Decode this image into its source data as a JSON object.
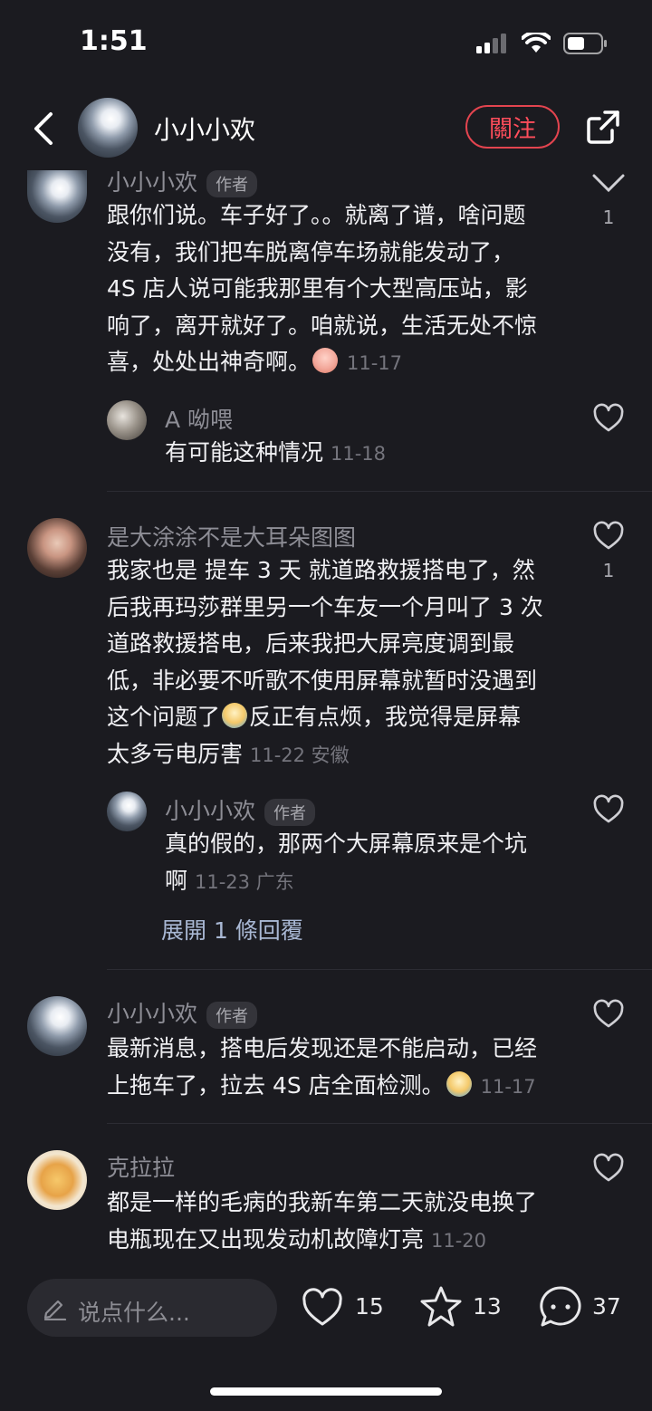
{
  "status": {
    "time": "1:51"
  },
  "header": {
    "name": "小小小欢",
    "follow_label": "關注"
  },
  "comments": [
    {
      "name": "小小小欢",
      "author_badge": "作者",
      "lines": [
        "跟你们说。车子好了。。就离了谱，啥问题",
        "没有，我们把车脱离停车场就能发动了，",
        "4S 店人说可能我那里有个大型高压站，影",
        "响了，离开就好了。咱就说，生活无处不惊",
        "喜，处处出神奇啊。"
      ],
      "date": "11-17",
      "likes": "1",
      "reply": {
        "name": "A 呦喂",
        "text": "有可能这种情况",
        "date": "11-18"
      }
    },
    {
      "name": "是大涂涂不是大耳朵图图",
      "lines": [
        "我家也是 提车 3 天 就道路救援搭电了，然",
        "后我再玛莎群里另一个车友一个月叫了 3 次",
        "道路救援搭电，后来我把大屏亮度调到最",
        "低，非必要不听歌不使用屏幕就暂时没遇到",
        "这个问题了",
        "反正有点烦，我觉得是屏幕",
        "太多亏电厉害"
      ],
      "date": "11-22 安徽",
      "likes": "1",
      "reply": {
        "name": "小小小欢",
        "author_badge": "作者",
        "lines": [
          "真的假的，那两个大屏幕原来是个坑",
          "啊"
        ],
        "date": "11-23 广东"
      },
      "expand_label": "展開 1 條回覆"
    },
    {
      "name": "小小小欢",
      "author_badge": "作者",
      "lines": [
        "最新消息，搭电后发现还是不能启动，已经",
        "上拖车了，拉去 4S 店全面检测。"
      ],
      "date": "11-17"
    },
    {
      "name": "克拉拉",
      "lines": [
        "都是一样的毛病的我新车第二天就没电换了",
        "电瓶现在又出现发动机故障灯亮"
      ],
      "date": "11-20"
    }
  ],
  "bottom": {
    "input_placeholder": "说点什么...",
    "likes": "15",
    "favorites": "13",
    "comments": "37"
  }
}
